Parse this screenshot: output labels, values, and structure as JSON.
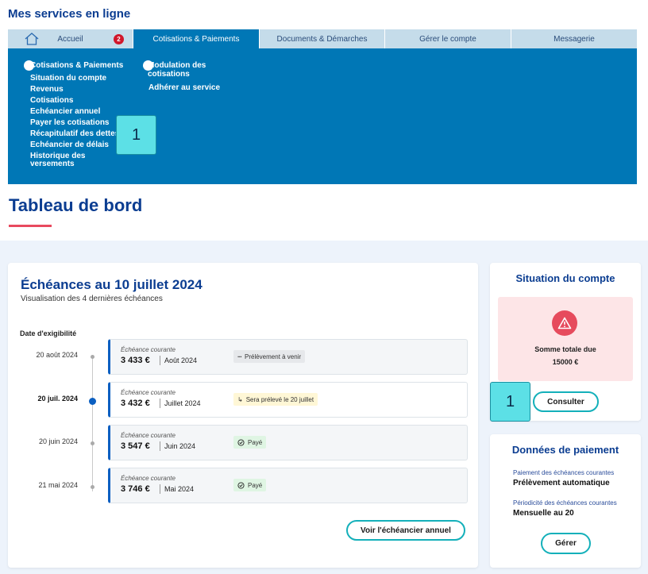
{
  "app": {
    "title": "Mes services en ligne"
  },
  "nav": {
    "badge": "2",
    "tabs": [
      {
        "label": "Accueil"
      },
      {
        "label": "Cotisations & Paiements"
      },
      {
        "label": "Documents & Démarches"
      },
      {
        "label": "Gérer le compte"
      },
      {
        "label": "Messagerie"
      }
    ]
  },
  "mega_menu": {
    "col1": {
      "heading": "Cotisations & Paiements",
      "items": [
        "Situation du compte",
        "Revenus",
        "Cotisations",
        "Echéancier annuel",
        "Payer les cotisations",
        "Récapitulatif des dettes",
        "Echéancier de délais",
        "Historique des versements"
      ]
    },
    "col2": {
      "heading": "Modulation des cotisations",
      "items": [
        "Adhérer au service"
      ]
    }
  },
  "markers": {
    "m1": "1",
    "m2": "1"
  },
  "page": {
    "title": "Tableau de bord"
  },
  "echeances": {
    "title": "Échéances au 10 juillet 2024",
    "subtitle": "Visualisation des 4 dernières échéances",
    "date_header": "Date d'exigibilité",
    "items": [
      {
        "date": "20 août 2024",
        "label": "Échéance courante",
        "amount": "3 433 €",
        "month": "Août 2024",
        "status": "Prélèvement à venir"
      },
      {
        "date": "20 juil. 2024",
        "label": "Échéance courante",
        "amount": "3 432 €",
        "month": "Juillet 2024",
        "status": "Sera prélevé le 20 juillet"
      },
      {
        "date": "20 juin 2024",
        "label": "Échéance courante",
        "amount": "3 547 €",
        "month": "Juin 2024",
        "status": "Payé"
      },
      {
        "date": "21 mai 2024",
        "label": "Échéance courante",
        "amount": "3 746 €",
        "month": "Mai 2024",
        "status": "Payé"
      }
    ],
    "button": "Voir l'échéancier annuel"
  },
  "situation": {
    "title": "Situation du compte",
    "alert_title": "Somme totale due",
    "alert_amount": "15000 €",
    "button": "Consulter"
  },
  "paiement": {
    "title": "Données de paiement",
    "label1": "Paiement des échéances courantes",
    "value1": "Prélèvement automatique",
    "label2": "Périodicité des échéances courantes",
    "value2": "Mensuelle au 20",
    "button": "Gérer"
  },
  "colors": {
    "primary": "#0077b6",
    "title": "#0b3d91",
    "accent": "#e84a5f",
    "button_border": "#14b0ba"
  }
}
